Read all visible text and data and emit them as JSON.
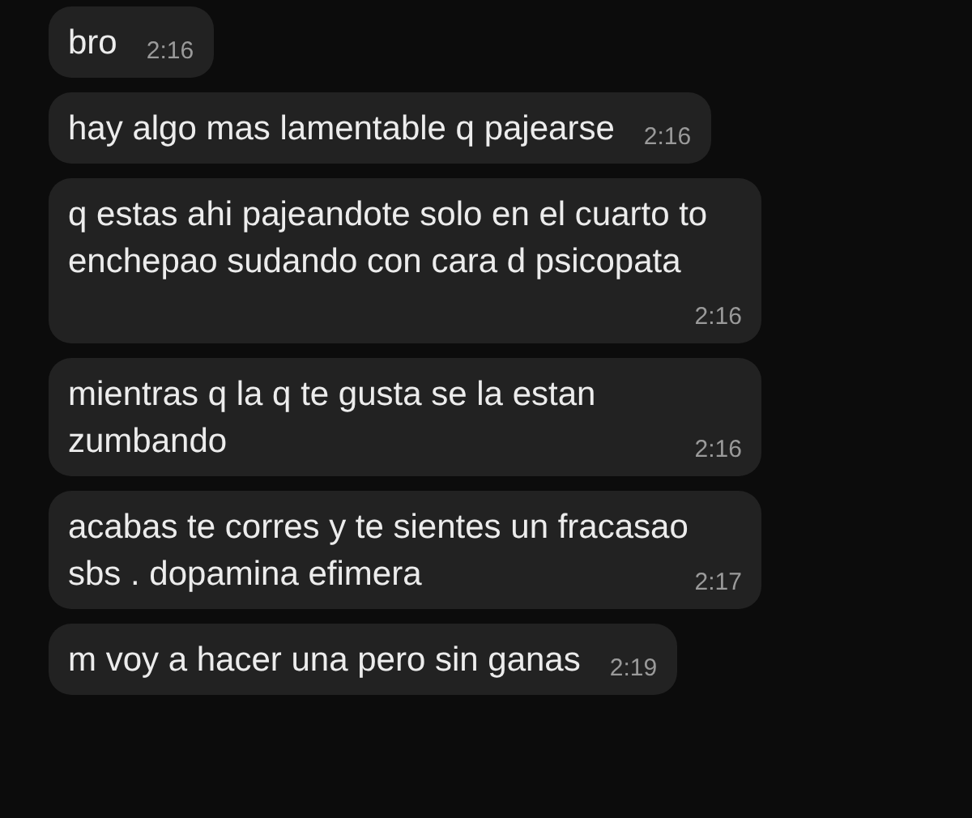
{
  "messages": [
    {
      "text": "bro",
      "time": "2:16"
    },
    {
      "text": "hay algo mas lamentable q pajearse",
      "time": "2:16"
    },
    {
      "text": "q estas ahi pajeandote solo en el cuarto to enchepao sudando con cara d psicopata",
      "time": "2:16"
    },
    {
      "text": "mientras q la q te gusta se la estan zumbando",
      "time": "2:16"
    },
    {
      "text": "acabas te corres y te sientes un fracasao sbs . dopamina efimera",
      "time": "2:17"
    },
    {
      "text": "m voy a hacer una pero sin ganas",
      "time": "2:19"
    }
  ]
}
